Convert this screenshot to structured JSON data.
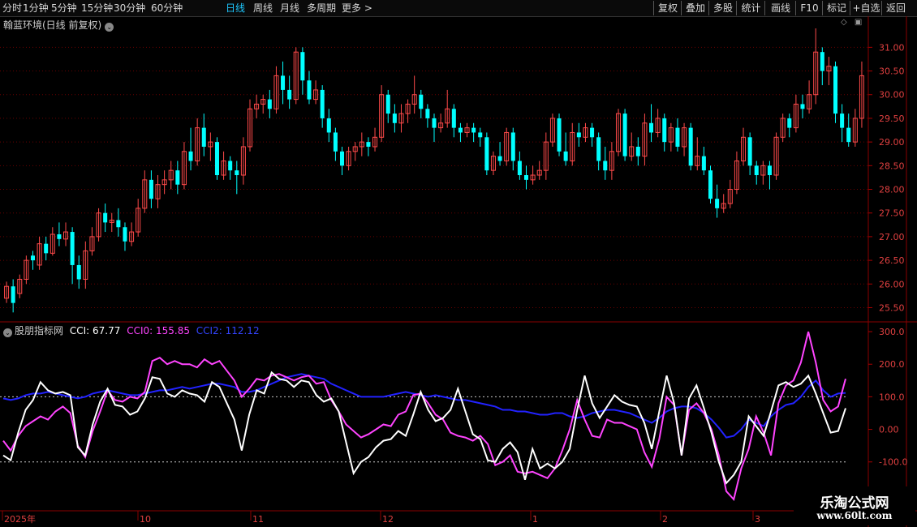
{
  "toolbar": {
    "periods": [
      "分时",
      "1分钟",
      "5分钟",
      "15分钟",
      "30分钟",
      "60分钟",
      "日线",
      "周线",
      "月线",
      "多周期",
      "更多 >"
    ],
    "active_period": "日线",
    "right_buttons": [
      "复权",
      "叠加",
      "多股",
      "统计",
      "画线",
      "F10",
      "标记",
      "+自选",
      "返回"
    ]
  },
  "main_chart": {
    "title": "翰蓝环境(日线 前复权)",
    "y_ticks": [
      "31.00",
      "30.50",
      "30.00",
      "29.50",
      "29.00",
      "28.50",
      "28.00",
      "27.50",
      "27.00",
      "26.50",
      "26.00",
      "25.50"
    ]
  },
  "indicator": {
    "name": "股朋指标网",
    "cci_label": "CCI: 67.77",
    "cci0_label": "CCI0: 155.85",
    "cci2_label": "CCI2: 112.12",
    "y_ticks": [
      "300.0",
      "200.0",
      "100.0",
      "0.00",
      "-100.0"
    ]
  },
  "x_axis": {
    "labels": [
      "2025年",
      "10",
      "11",
      "12",
      "1",
      "2",
      "3"
    ]
  },
  "watermark": {
    "title": "乐淘公式网",
    "url": "www.60lt.com"
  },
  "colors": {
    "up": "#ff4a4a",
    "down": "#00ffff",
    "cci": "#ffffff",
    "cci0": "#ff44ff",
    "cci2": "#2222ff",
    "grid": "#6a0000"
  },
  "chart_data": {
    "type": "candlestick",
    "ylim": [
      25.2,
      31.4
    ],
    "candles": [
      [
        25.7,
        25.95,
        25.6,
        26.05
      ],
      [
        25.95,
        25.6,
        25.4,
        26.1
      ],
      [
        25.8,
        26.1,
        25.7,
        26.2
      ],
      [
        26.1,
        26.5,
        26.0,
        26.6
      ],
      [
        26.6,
        26.5,
        26.3,
        26.7
      ],
      [
        26.4,
        26.85,
        26.3,
        27.0
      ],
      [
        26.85,
        26.65,
        26.5,
        27.0
      ],
      [
        26.65,
        27.05,
        26.6,
        27.2
      ],
      [
        27.05,
        26.95,
        26.8,
        27.3
      ],
      [
        26.95,
        27.1,
        26.8,
        27.3
      ],
      [
        27.1,
        26.4,
        26.0,
        27.2
      ],
      [
        26.4,
        26.1,
        25.9,
        26.6
      ],
      [
        26.1,
        26.7,
        25.9,
        26.9
      ],
      [
        26.7,
        27.0,
        26.6,
        27.2
      ],
      [
        27.0,
        27.5,
        26.9,
        27.6
      ],
      [
        27.5,
        27.3,
        27.1,
        27.7
      ],
      [
        27.3,
        27.35,
        27.1,
        27.5
      ],
      [
        27.35,
        27.2,
        27.0,
        27.6
      ],
      [
        27.2,
        26.9,
        26.7,
        27.3
      ],
      [
        26.9,
        27.1,
        26.8,
        27.3
      ],
      [
        27.1,
        27.6,
        27.0,
        27.8
      ],
      [
        27.6,
        28.2,
        27.5,
        28.4
      ],
      [
        28.2,
        27.8,
        27.6,
        28.4
      ],
      [
        27.8,
        28.1,
        27.6,
        28.3
      ],
      [
        28.1,
        28.2,
        27.9,
        28.4
      ],
      [
        28.2,
        28.4,
        28.0,
        28.6
      ],
      [
        28.4,
        28.1,
        27.9,
        28.6
      ],
      [
        28.1,
        28.8,
        28.0,
        29.0
      ],
      [
        28.8,
        28.6,
        28.4,
        29.3
      ],
      [
        28.6,
        29.3,
        28.5,
        29.5
      ],
      [
        29.3,
        28.9,
        28.7,
        29.6
      ],
      [
        28.9,
        29.0,
        28.6,
        29.2
      ],
      [
        29.0,
        28.3,
        28.2,
        29.1
      ],
      [
        28.3,
        28.6,
        28.2,
        28.8
      ],
      [
        28.6,
        28.4,
        28.2,
        28.7
      ],
      [
        28.4,
        28.3,
        27.9,
        28.6
      ],
      [
        28.3,
        28.9,
        28.1,
        29.1
      ],
      [
        28.9,
        29.7,
        28.8,
        29.9
      ],
      [
        29.7,
        29.8,
        29.5,
        30.0
      ],
      [
        29.8,
        29.9,
        29.6,
        30.0
      ],
      [
        29.9,
        29.7,
        29.5,
        30.1
      ],
      [
        29.7,
        30.4,
        29.6,
        30.6
      ],
      [
        30.4,
        30.1,
        29.8,
        30.7
      ],
      [
        30.1,
        29.9,
        29.7,
        30.4
      ],
      [
        29.9,
        30.9,
        29.8,
        31.0
      ],
      [
        30.9,
        30.3,
        30.0,
        31.0
      ],
      [
        30.3,
        29.9,
        29.8,
        30.5
      ],
      [
        29.9,
        30.1,
        29.8,
        30.3
      ],
      [
        30.1,
        29.5,
        29.3,
        30.2
      ],
      [
        29.5,
        29.2,
        29.0,
        29.7
      ],
      [
        29.2,
        28.8,
        28.6,
        29.3
      ],
      [
        28.8,
        28.5,
        28.3,
        28.9
      ],
      [
        28.5,
        28.8,
        28.4,
        28.9
      ],
      [
        28.8,
        28.9,
        28.6,
        29.0
      ],
      [
        28.9,
        29.0,
        28.7,
        29.2
      ],
      [
        29.0,
        28.9,
        28.7,
        29.1
      ],
      [
        28.9,
        29.1,
        28.8,
        29.3
      ],
      [
        29.1,
        30.0,
        29.0,
        30.2
      ],
      [
        30.0,
        29.6,
        29.4,
        30.1
      ],
      [
        29.6,
        29.4,
        29.2,
        29.8
      ],
      [
        29.4,
        29.6,
        29.2,
        29.8
      ],
      [
        29.6,
        29.8,
        29.4,
        29.9
      ],
      [
        29.8,
        30.0,
        29.6,
        30.4
      ],
      [
        30.0,
        29.7,
        29.5,
        30.1
      ],
      [
        29.7,
        29.5,
        29.3,
        29.8
      ],
      [
        29.5,
        29.3,
        29.0,
        29.6
      ],
      [
        29.3,
        29.4,
        29.2,
        29.6
      ],
      [
        29.4,
        29.7,
        29.3,
        30.1
      ],
      [
        29.7,
        29.3,
        29.1,
        29.8
      ],
      [
        29.3,
        29.2,
        29.0,
        29.4
      ],
      [
        29.2,
        29.3,
        29.1,
        29.4
      ],
      [
        29.3,
        29.2,
        29.0,
        29.4
      ],
      [
        29.2,
        29.1,
        28.9,
        29.3
      ],
      [
        29.1,
        28.4,
        28.3,
        29.2
      ],
      [
        28.4,
        28.7,
        28.3,
        28.8
      ],
      [
        28.7,
        28.6,
        28.5,
        29.0
      ],
      [
        28.6,
        29.2,
        28.5,
        29.3
      ],
      [
        29.2,
        28.6,
        28.4,
        29.3
      ],
      [
        28.6,
        28.3,
        28.2,
        28.8
      ],
      [
        28.3,
        28.2,
        28.0,
        28.5
      ],
      [
        28.2,
        28.3,
        28.1,
        28.5
      ],
      [
        28.3,
        28.4,
        28.2,
        28.6
      ],
      [
        28.4,
        29.0,
        28.2,
        29.2
      ],
      [
        29.0,
        29.5,
        28.9,
        29.6
      ],
      [
        29.5,
        28.8,
        28.7,
        29.6
      ],
      [
        28.8,
        28.6,
        28.5,
        29.2
      ],
      [
        28.6,
        29.2,
        28.5,
        29.4
      ],
      [
        29.2,
        29.1,
        28.9,
        29.4
      ],
      [
        29.1,
        29.3,
        29.0,
        29.4
      ],
      [
        29.3,
        29.1,
        28.9,
        29.4
      ],
      [
        29.1,
        28.6,
        28.4,
        29.2
      ],
      [
        28.6,
        28.4,
        28.2,
        28.9
      ],
      [
        28.4,
        28.8,
        28.2,
        29.0
      ],
      [
        28.8,
        29.6,
        28.7,
        29.7
      ],
      [
        29.6,
        28.7,
        28.6,
        29.7
      ],
      [
        28.7,
        28.9,
        28.6,
        29.2
      ],
      [
        28.9,
        28.7,
        28.5,
        29.1
      ],
      [
        28.7,
        29.4,
        28.5,
        29.6
      ],
      [
        29.4,
        29.2,
        29.0,
        29.8
      ],
      [
        29.2,
        29.5,
        29.1,
        29.7
      ],
      [
        29.5,
        29.0,
        28.8,
        29.6
      ],
      [
        29.0,
        29.3,
        28.8,
        29.4
      ],
      [
        29.3,
        28.9,
        28.8,
        29.5
      ],
      [
        28.9,
        29.3,
        28.7,
        29.4
      ],
      [
        29.3,
        28.5,
        28.4,
        29.4
      ],
      [
        28.5,
        28.7,
        28.4,
        29.1
      ],
      [
        28.7,
        28.4,
        28.3,
        28.9
      ],
      [
        28.4,
        27.8,
        27.7,
        28.5
      ],
      [
        27.8,
        27.6,
        27.4,
        28.1
      ],
      [
        27.6,
        27.7,
        27.5,
        27.9
      ],
      [
        27.7,
        28.0,
        27.6,
        28.2
      ],
      [
        28.0,
        28.6,
        27.9,
        28.8
      ],
      [
        28.6,
        29.1,
        28.5,
        29.3
      ],
      [
        29.1,
        28.5,
        28.3,
        29.2
      ],
      [
        28.5,
        28.3,
        28.1,
        28.6
      ],
      [
        28.3,
        28.5,
        28.1,
        28.6
      ],
      [
        28.5,
        28.3,
        28.0,
        28.6
      ],
      [
        28.3,
        29.1,
        28.2,
        29.2
      ],
      [
        29.1,
        29.5,
        29.0,
        29.6
      ],
      [
        29.5,
        29.3,
        29.1,
        29.6
      ],
      [
        29.3,
        29.8,
        29.2,
        30.0
      ],
      [
        29.8,
        29.7,
        29.5,
        30.0
      ],
      [
        29.7,
        30.0,
        29.6,
        30.3
      ],
      [
        30.0,
        30.9,
        29.8,
        31.4
      ],
      [
        30.9,
        30.5,
        30.2,
        31.0
      ],
      [
        30.5,
        30.6,
        30.2,
        30.8
      ],
      [
        30.6,
        29.6,
        29.4,
        30.7
      ],
      [
        29.6,
        29.3,
        29.0,
        29.8
      ],
      [
        29.3,
        29.0,
        28.9,
        29.6
      ],
      [
        29.0,
        29.5,
        28.9,
        29.7
      ],
      [
        29.5,
        30.4,
        29.3,
        30.7
      ]
    ],
    "cci": [
      -80,
      -95,
      -10,
      60,
      90,
      145,
      120,
      110,
      115,
      105,
      -55,
      -80,
      15,
      85,
      125,
      75,
      70,
      45,
      55,
      95,
      160,
      155,
      110,
      100,
      120,
      110,
      105,
      85,
      145,
      130,
      80,
      30,
      -65,
      45,
      120,
      110,
      175,
      155,
      150,
      130,
      150,
      145,
      105,
      85,
      95,
      55,
      -40,
      -135,
      -100,
      -85,
      -55,
      -35,
      -30,
      -5,
      -20,
      45,
      115,
      60,
      25,
      35,
      60,
      125,
      55,
      -15,
      -30,
      -95,
      -100,
      -60,
      -40,
      -70,
      -155,
      -60,
      -120,
      -105,
      -120,
      -100,
      -60,
      60,
      165,
      80,
      35,
      70,
      105,
      85,
      75,
      70,
      20,
      -60,
      55,
      165,
      80,
      -80,
      95,
      135,
      65,
      -10,
      -100,
      -165,
      -140,
      -100,
      40,
      10,
      -20,
      55,
      135,
      145,
      130,
      140,
      165,
      110,
      50,
      -10,
      -5,
      65
    ],
    "cci0": [
      -35,
      -65,
      -20,
      10,
      25,
      40,
      30,
      55,
      70,
      50,
      -50,
      -85,
      -5,
      55,
      120,
      90,
      85,
      100,
      95,
      115,
      210,
      220,
      200,
      210,
      200,
      200,
      190,
      215,
      200,
      210,
      180,
      150,
      100,
      125,
      155,
      150,
      165,
      170,
      160,
      150,
      160,
      165,
      140,
      145,
      90,
      55,
      15,
      -5,
      -25,
      -15,
      0,
      15,
      10,
      45,
      55,
      105,
      110,
      80,
      45,
      30,
      -10,
      -20,
      -25,
      -35,
      -20,
      -45,
      -110,
      -100,
      -80,
      -130,
      -135,
      -130,
      -140,
      -150,
      -120,
      -65,
      0,
      90,
      30,
      -20,
      -25,
      30,
      20,
      20,
      10,
      0,
      -70,
      -115,
      -30,
      100,
      75,
      -80,
      60,
      80,
      50,
      0,
      -80,
      -190,
      -215,
      -120,
      -60,
      40,
      -10,
      -80,
      80,
      135,
      150,
      205,
      300,
      205,
      90,
      55,
      70,
      155
    ],
    "cci2": [
      95,
      90,
      95,
      105,
      110,
      110,
      115,
      110,
      105,
      100,
      95,
      100,
      110,
      115,
      120,
      115,
      110,
      105,
      105,
      110,
      115,
      120,
      120,
      125,
      130,
      125,
      130,
      135,
      140,
      140,
      135,
      130,
      115,
      115,
      120,
      130,
      140,
      150,
      160,
      165,
      170,
      165,
      160,
      155,
      140,
      130,
      120,
      110,
      100,
      100,
      100,
      100,
      105,
      110,
      115,
      110,
      105,
      100,
      105,
      100,
      95,
      90,
      90,
      85,
      80,
      75,
      70,
      60,
      60,
      55,
      55,
      50,
      45,
      45,
      50,
      50,
      40,
      35,
      40,
      50,
      55,
      60,
      60,
      55,
      50,
      40,
      30,
      20,
      35,
      55,
      65,
      70,
      70,
      65,
      50,
      30,
      5,
      -25,
      -20,
      0,
      30,
      20,
      10,
      40,
      60,
      75,
      80,
      100,
      130,
      150,
      120,
      100,
      110,
      112
    ]
  }
}
